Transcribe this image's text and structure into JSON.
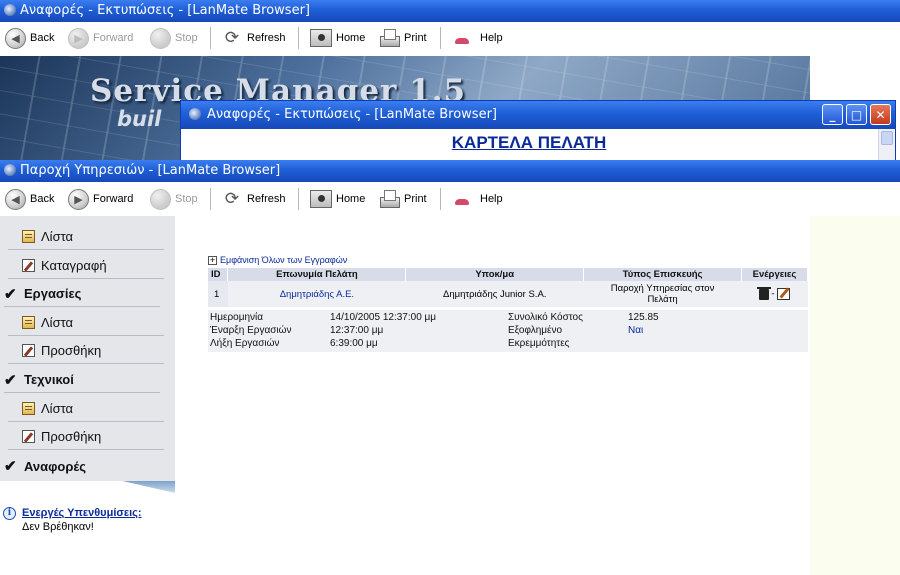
{
  "back_window": {
    "title": "Αναφορές - Εκτυπώσεις - [LanMate Browser]",
    "toolbar": {
      "back": "Back",
      "forward": "Forward",
      "stop": "Stop",
      "refresh": "Refresh",
      "home": "Home",
      "print": "Print",
      "help": "Help"
    },
    "banner": {
      "title": "Service Manager 1.5",
      "subtitle": "buil"
    }
  },
  "popup_window": {
    "title": "Αναφορές - Εκτυπώσεις - [LanMate Browser]",
    "heading": "ΚΑΡΤΕΛΑ ΠΕΛΑΤΗ"
  },
  "main_window": {
    "title": "Παροχή Υπηρεσιών - [LanMate Browser]",
    "toolbar": {
      "back": "Back",
      "forward": "Forward",
      "stop": "Stop",
      "refresh": "Refresh",
      "home": "Home",
      "print": "Print",
      "help": "Help"
    }
  },
  "sidebar": {
    "items": [
      {
        "label": "Λίστα"
      },
      {
        "label": "Καταγραφή"
      },
      {
        "label": "Εργασίες"
      },
      {
        "label": "Λίστα"
      },
      {
        "label": "Προσθήκη"
      },
      {
        "label": "Τεχνικοί"
      },
      {
        "label": "Λίστα"
      },
      {
        "label": "Προσθήκη"
      },
      {
        "label": "Αναφορές"
      }
    ]
  },
  "reminders": {
    "title": "Ενεργές Υπενθυμίσεις:",
    "text": "Δεν Βρέθηκαν!"
  },
  "records": {
    "show_all": "Εμφάνιση Όλων των Εγγραφών",
    "columns": [
      "ID",
      "Επωνυμία Πελάτη",
      "Υποκ/μα",
      "Τύπος Επισκευής",
      "Ενέργειες"
    ],
    "row": {
      "id": "1",
      "client": "Δημητριάδης Α.Ε.",
      "branch": "Δημητριάδης Junior S.A.",
      "type_line1": "Παροχή Υπηρεσίας στον",
      "type_line2": "Πελάτη",
      "actions_sep": "-"
    },
    "details": {
      "date_label": "Ημερομηνία",
      "date_value": "14/10/2005 12:37:00 μμ",
      "start_label": "Έναρξη Εργασιών",
      "start_value": "12:37:00 μμ",
      "end_label": "Λήξη Εργασιών",
      "end_value": "6:39:00 μμ",
      "cost_label": "Συνολικό Κόστος",
      "cost_value": "125.85",
      "paid_label": "Εξοφλημένο",
      "paid_value": "Ναι",
      "pending_label": "Εκρεμμότητες"
    }
  }
}
